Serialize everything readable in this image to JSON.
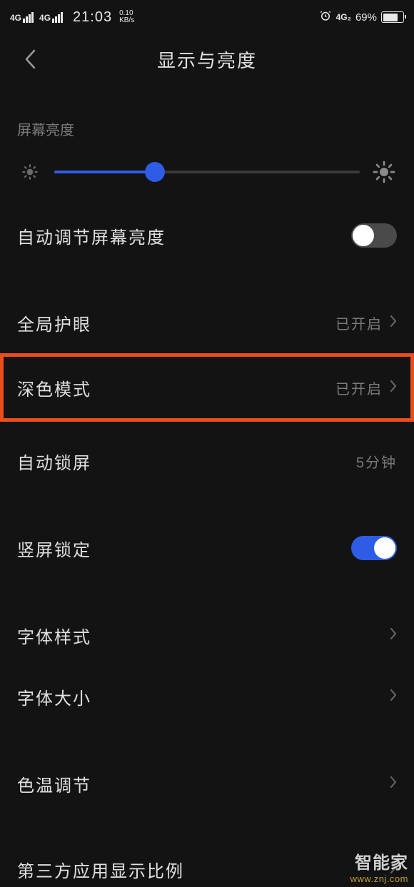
{
  "statusBar": {
    "signal1": "4G",
    "signal2": "4G",
    "time": "21:03",
    "speed": "0.10",
    "speedUnit": "KB/s",
    "netBadge": "4G₂",
    "battery": "69%"
  },
  "header": {
    "title": "显示与亮度"
  },
  "sections": {
    "brightnessLabel": "屏幕亮度",
    "autoAdjust": {
      "label": "自动调节屏幕亮度",
      "on": false
    },
    "eyeCare": {
      "label": "全局护眼",
      "value": "已开启"
    },
    "darkMode": {
      "label": "深色模式",
      "value": "已开启"
    },
    "autoLock": {
      "label": "自动锁屏",
      "value": "5分钟"
    },
    "orientationLock": {
      "label": "竖屏锁定",
      "on": true
    },
    "fontStyle": {
      "label": "字体样式"
    },
    "fontSize": {
      "label": "字体大小"
    },
    "colorTemp": {
      "label": "色温调节"
    },
    "thirdParty": {
      "label": "第三方应用显示比例"
    }
  },
  "watermark": {
    "main": "智能家",
    "sub": "www.znj.com"
  }
}
